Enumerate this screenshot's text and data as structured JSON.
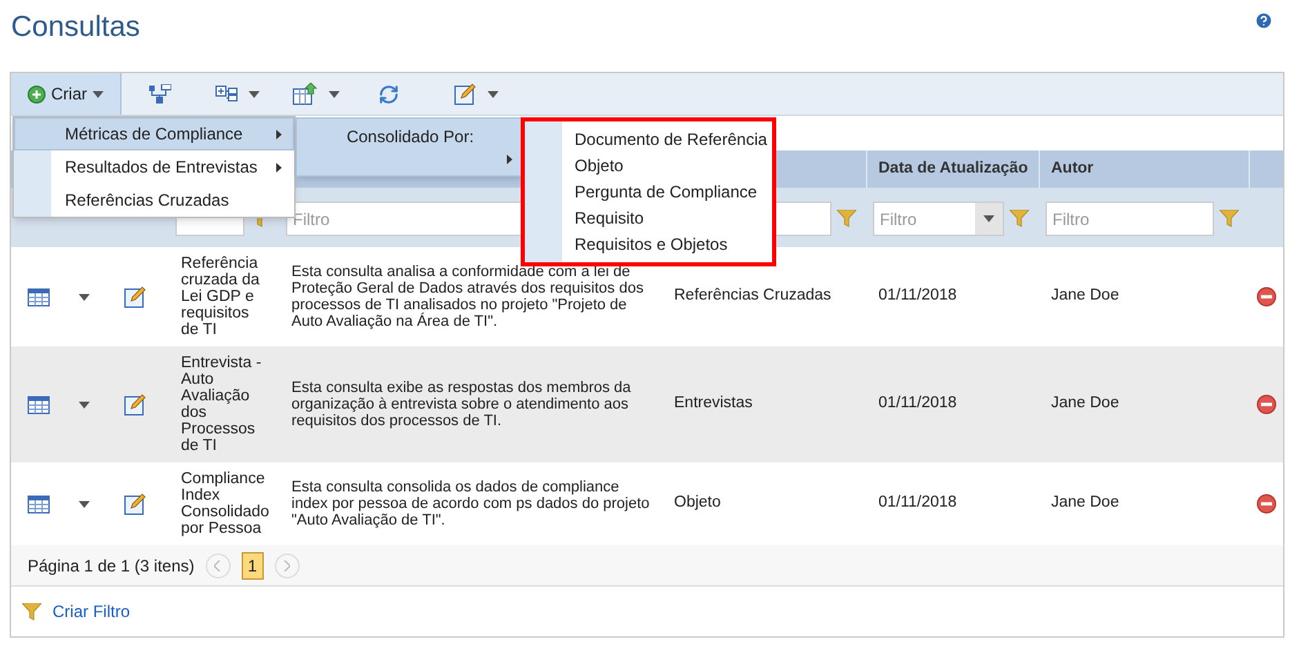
{
  "page": {
    "title": "Consultas"
  },
  "toolbar": {
    "create_label": "Criar",
    "create_open": true
  },
  "menu": [
    {
      "label": "Métricas de Compliance",
      "selected": true,
      "has_submenu": true
    },
    {
      "label": "Resultados de Entrevistas",
      "selected": false,
      "has_submenu": true
    },
    {
      "label": "Referências Cruzadas",
      "selected": false,
      "has_submenu": false
    }
  ],
  "submenu": {
    "label": "Consolidado Por:"
  },
  "consolidado_options": [
    "Documento de Referência",
    "Objeto",
    "Pergunta de Compliance",
    "Requisito",
    "Requisitos e Objetos"
  ],
  "table": {
    "columns": [
      "Data de Atualização",
      "Autor"
    ],
    "filters": [
      {
        "kind": "text"
      },
      {
        "kind": "text",
        "placeholder": "Filtro"
      },
      {
        "kind": "text"
      },
      {
        "kind": "select",
        "placeholder": "Filtro"
      },
      {
        "kind": "text",
        "placeholder": "Filtro"
      }
    ],
    "rows": [
      {
        "name": "Referência cruzada da Lei GDP e requisitos de TI",
        "description": "Esta consulta analisa a conformidade com a lei de Proteção Geral de Dados através dos requisitos dos processos de TI analisados no projeto \"Projeto de Auto Avaliação na Área de TI\".",
        "type": "Referências Cruzadas",
        "date": "01/11/2018",
        "author": "Jane Doe"
      },
      {
        "name": "Entrevista - Auto Avaliação dos Processos de TI",
        "description": "Esta consulta exibe as respostas dos membros da organização à entrevista sobre o atendimento aos requisitos dos processos de TI.",
        "type": "Entrevistas",
        "date": "01/11/2018",
        "author": "Jane Doe"
      },
      {
        "name": "Compliance Index Consolidado por Pessoa",
        "description": "Esta consulta consolida os dados de compliance index por pessoa de acordo com ps dados do projeto \"Auto Avaliação de TI\".",
        "type": "Objeto",
        "date": "01/11/2018",
        "author": "Jane Doe"
      }
    ]
  },
  "pager": {
    "summary": "Página 1 de 1 (3 itens)",
    "pages": [
      {
        "label": "1",
        "selected": true
      }
    ]
  },
  "footer": {
    "link": "Criar Filtro"
  }
}
